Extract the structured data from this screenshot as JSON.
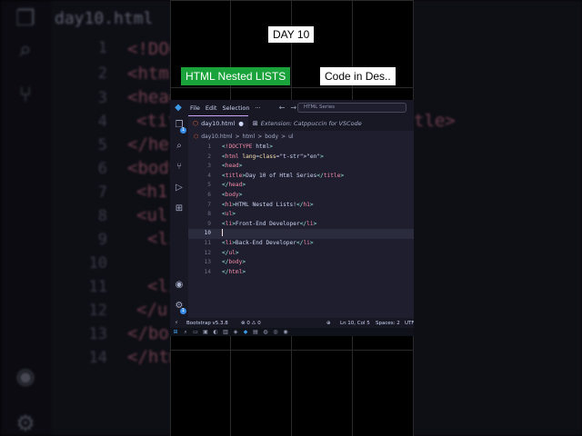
{
  "background": {
    "tab_label": "day10.html",
    "line_numbers": [
      "1",
      "2",
      "3",
      "4",
      "5",
      "6",
      "7",
      "8",
      "9",
      "10",
      "11",
      "12",
      "13",
      "14"
    ],
    "lines": [
      "<!DOC",
      "<html",
      "<head",
      "<title",
      "</he",
      "<body",
      "<h1",
      "<ul",
      "<li",
      "",
      "<li",
      "</u",
      "</bo",
      "</htm"
    ],
    "right_fragments": [
      "tle>"
    ]
  },
  "overlay": {
    "day_label": "DAY 10",
    "topic_label": "HTML Nested LISTS",
    "code_label": "Code in Des.."
  },
  "vscode": {
    "menu": [
      "File",
      "Edit",
      "Selection",
      "···"
    ],
    "command_center": "HTML Series",
    "tabs": [
      {
        "label": "day10.html",
        "icon": "html5-icon",
        "active": true,
        "modified": true
      },
      {
        "label": "Extension: Catppuccin for VSCode",
        "icon": "extension-icon",
        "active": false
      }
    ],
    "breadcrumb": [
      "day10.html",
      ">",
      "html",
      ">",
      "body",
      ">",
      "ul"
    ],
    "current_line": 10,
    "code_lines": [
      {
        "n": "1",
        "html": "<!DOCTYPE html>"
      },
      {
        "n": "2",
        "html": "<html lang=\"en\">"
      },
      {
        "n": "3",
        "html": "<head>"
      },
      {
        "n": "4",
        "html": " <title>Day 10 of Html Series</title>"
      },
      {
        "n": "5",
        "html": "</head>"
      },
      {
        "n": "6",
        "html": "<body>"
      },
      {
        "n": "7",
        "html": " <h1>HTML Nested Lists!</h1>"
      },
      {
        "n": "8",
        "html": " <ul>"
      },
      {
        "n": "9",
        "html": "  <li>Front-End Developer</li>"
      },
      {
        "n": "10",
        "html": "  "
      },
      {
        "n": "11",
        "html": "  <li>Back-End Developer</li>"
      },
      {
        "n": "12",
        "html": " </ul>"
      },
      {
        "n": "13",
        "html": "</body>"
      },
      {
        "n": "14",
        "html": "</html>"
      }
    ],
    "status": {
      "remote": "⚡",
      "extension": "Bootstrap v5.3.8",
      "problems": "⊗ 0 ⚠ 0",
      "zoom": "⊕",
      "position": "Ln 10, Col 5",
      "spaces": "Spaces: 2",
      "encoding": "UTF"
    },
    "colors": {
      "editor_bg": "#1e1e2e",
      "panel_bg": "#181825",
      "tag": "#f38ba8",
      "bracket": "#94e2d5",
      "attribute": "#f9e2af",
      "string": "#a6e3a1",
      "accent_badge": "#3b8ee8",
      "topic_green": "#1aa33a"
    }
  }
}
